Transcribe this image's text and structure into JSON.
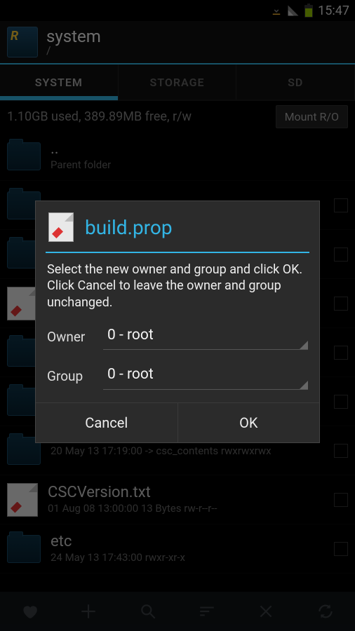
{
  "statusbar": {
    "time": "15:47"
  },
  "header": {
    "title": "system",
    "path": "/"
  },
  "tabs": [
    {
      "label": "SYSTEM",
      "active": true
    },
    {
      "label": "STORAGE",
      "active": false
    },
    {
      "label": "SD",
      "active": false
    }
  ],
  "status": {
    "text": "1.10GB used, 389.89MB free, r/w",
    "mount_label": "Mount R/O"
  },
  "files": [
    {
      "icon": "folder",
      "name": "..",
      "meta": "Parent folder",
      "checkbox": false
    },
    {
      "icon": "folder",
      "name": "",
      "meta": "",
      "checkbox": true
    },
    {
      "icon": "folder",
      "name": "",
      "meta": "",
      "checkbox": true
    },
    {
      "icon": "file",
      "name": "",
      "meta": "",
      "checkbox": true
    },
    {
      "icon": "folder",
      "name": "",
      "meta": "",
      "checkbox": true
    },
    {
      "icon": "folder",
      "name": "",
      "meta": "",
      "checkbox": true
    },
    {
      "icon": "folder",
      "name": "",
      "meta": "20 May 13 17:19:00  -> csc_contents  rwxrwxrwx",
      "checkbox": true
    },
    {
      "icon": "file",
      "name": "CSCVersion.txt",
      "meta": "01 Aug 08 13:00:00  13 Bytes  rw-r--r--",
      "checkbox": true
    },
    {
      "icon": "folder",
      "name": "etc",
      "meta": "24 May 13 17:43:00   rwxr-xr-x",
      "checkbox": true
    }
  ],
  "dialog": {
    "title": "build.prop",
    "message": "Select the new owner and group and click OK. Click Cancel to leave the owner and group unchanged.",
    "owner_label": "Owner",
    "owner_value": "0 - root",
    "group_label": "Group",
    "group_value": "0 - root",
    "cancel_label": "Cancel",
    "ok_label": "OK"
  },
  "colors": {
    "accent": "#33b5e5"
  }
}
